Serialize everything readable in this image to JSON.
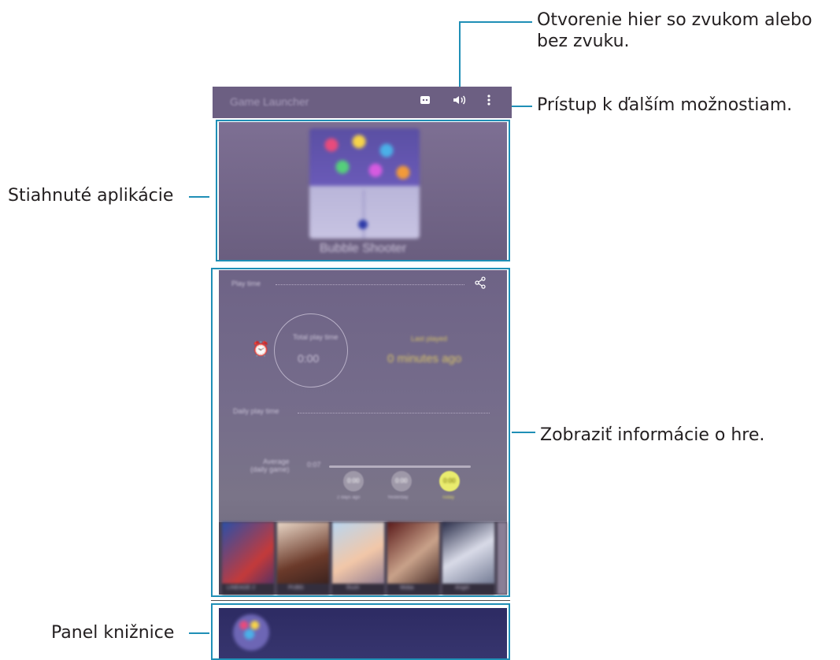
{
  "callouts": {
    "sound_toggle": "Otvorenie hier so zvukom alebo bez zvuku.",
    "more_options": "Prístup k ďalším možnostiam.",
    "downloaded_apps": "Stiahnuté aplikácie",
    "game_info": "Zobraziť informácie o hre.",
    "library_panel": "Panel knižnice"
  },
  "screen": {
    "app_title": "Game Launcher",
    "icons": [
      "discord-icon",
      "volume-icon",
      "more-options-icon"
    ],
    "featured_game": "Bubble Shooter",
    "stats": {
      "play_time_label": "Play time",
      "total_play_time_label": "Total play time",
      "total_play_time_value": "0:00",
      "last_played_label": "Last played",
      "last_played_value": "0 minutes ago",
      "daily_play_time_label": "Daily play time",
      "average_label": "Average\n(daily game)",
      "average_value": "0:07",
      "days": [
        {
          "value": "0:00",
          "label": "2 days ago"
        },
        {
          "value": "0:00",
          "label": "Yesterday"
        },
        {
          "value": "0:00",
          "label": "Today"
        }
      ]
    },
    "thumbnails": [
      {
        "caption": "LINEAGE 2"
      },
      {
        "caption": "PUBG"
      },
      {
        "caption": "Rush"
      },
      {
        "caption": "Moba"
      },
      {
        "caption": "Angel"
      }
    ]
  },
  "colors": {
    "accent": "#1f8fb6",
    "topbar": "#6c5f82",
    "today_dot": "#eaec6e"
  }
}
